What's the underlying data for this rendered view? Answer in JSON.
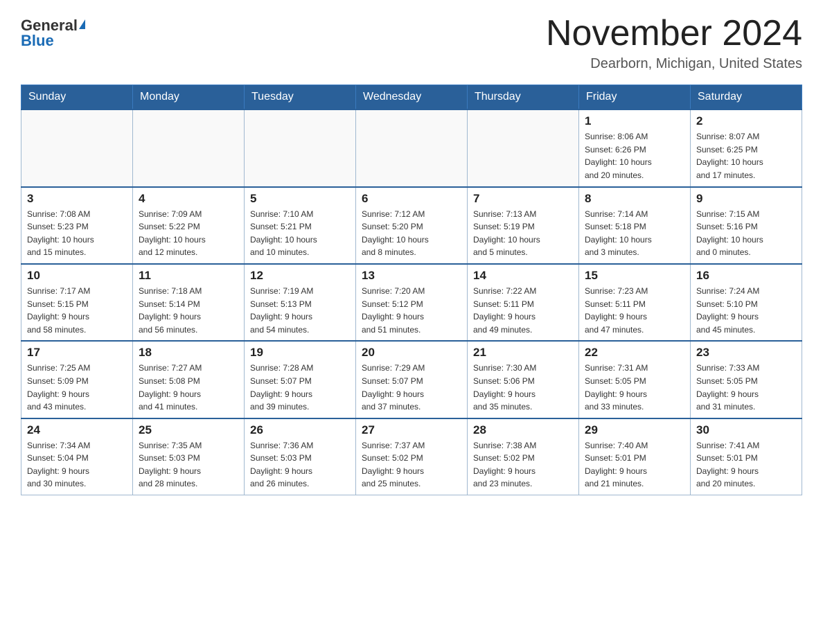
{
  "header": {
    "logo_general": "General",
    "logo_blue": "Blue",
    "month_title": "November 2024",
    "location": "Dearborn, Michigan, United States"
  },
  "weekdays": [
    "Sunday",
    "Monday",
    "Tuesday",
    "Wednesday",
    "Thursday",
    "Friday",
    "Saturday"
  ],
  "weeks": [
    [
      {
        "day": "",
        "info": ""
      },
      {
        "day": "",
        "info": ""
      },
      {
        "day": "",
        "info": ""
      },
      {
        "day": "",
        "info": ""
      },
      {
        "day": "",
        "info": ""
      },
      {
        "day": "1",
        "info": "Sunrise: 8:06 AM\nSunset: 6:26 PM\nDaylight: 10 hours\nand 20 minutes."
      },
      {
        "day": "2",
        "info": "Sunrise: 8:07 AM\nSunset: 6:25 PM\nDaylight: 10 hours\nand 17 minutes."
      }
    ],
    [
      {
        "day": "3",
        "info": "Sunrise: 7:08 AM\nSunset: 5:23 PM\nDaylight: 10 hours\nand 15 minutes."
      },
      {
        "day": "4",
        "info": "Sunrise: 7:09 AM\nSunset: 5:22 PM\nDaylight: 10 hours\nand 12 minutes."
      },
      {
        "day": "5",
        "info": "Sunrise: 7:10 AM\nSunset: 5:21 PM\nDaylight: 10 hours\nand 10 minutes."
      },
      {
        "day": "6",
        "info": "Sunrise: 7:12 AM\nSunset: 5:20 PM\nDaylight: 10 hours\nand 8 minutes."
      },
      {
        "day": "7",
        "info": "Sunrise: 7:13 AM\nSunset: 5:19 PM\nDaylight: 10 hours\nand 5 minutes."
      },
      {
        "day": "8",
        "info": "Sunrise: 7:14 AM\nSunset: 5:18 PM\nDaylight: 10 hours\nand 3 minutes."
      },
      {
        "day": "9",
        "info": "Sunrise: 7:15 AM\nSunset: 5:16 PM\nDaylight: 10 hours\nand 0 minutes."
      }
    ],
    [
      {
        "day": "10",
        "info": "Sunrise: 7:17 AM\nSunset: 5:15 PM\nDaylight: 9 hours\nand 58 minutes."
      },
      {
        "day": "11",
        "info": "Sunrise: 7:18 AM\nSunset: 5:14 PM\nDaylight: 9 hours\nand 56 minutes."
      },
      {
        "day": "12",
        "info": "Sunrise: 7:19 AM\nSunset: 5:13 PM\nDaylight: 9 hours\nand 54 minutes."
      },
      {
        "day": "13",
        "info": "Sunrise: 7:20 AM\nSunset: 5:12 PM\nDaylight: 9 hours\nand 51 minutes."
      },
      {
        "day": "14",
        "info": "Sunrise: 7:22 AM\nSunset: 5:11 PM\nDaylight: 9 hours\nand 49 minutes."
      },
      {
        "day": "15",
        "info": "Sunrise: 7:23 AM\nSunset: 5:11 PM\nDaylight: 9 hours\nand 47 minutes."
      },
      {
        "day": "16",
        "info": "Sunrise: 7:24 AM\nSunset: 5:10 PM\nDaylight: 9 hours\nand 45 minutes."
      }
    ],
    [
      {
        "day": "17",
        "info": "Sunrise: 7:25 AM\nSunset: 5:09 PM\nDaylight: 9 hours\nand 43 minutes."
      },
      {
        "day": "18",
        "info": "Sunrise: 7:27 AM\nSunset: 5:08 PM\nDaylight: 9 hours\nand 41 minutes."
      },
      {
        "day": "19",
        "info": "Sunrise: 7:28 AM\nSunset: 5:07 PM\nDaylight: 9 hours\nand 39 minutes."
      },
      {
        "day": "20",
        "info": "Sunrise: 7:29 AM\nSunset: 5:07 PM\nDaylight: 9 hours\nand 37 minutes."
      },
      {
        "day": "21",
        "info": "Sunrise: 7:30 AM\nSunset: 5:06 PM\nDaylight: 9 hours\nand 35 minutes."
      },
      {
        "day": "22",
        "info": "Sunrise: 7:31 AM\nSunset: 5:05 PM\nDaylight: 9 hours\nand 33 minutes."
      },
      {
        "day": "23",
        "info": "Sunrise: 7:33 AM\nSunset: 5:05 PM\nDaylight: 9 hours\nand 31 minutes."
      }
    ],
    [
      {
        "day": "24",
        "info": "Sunrise: 7:34 AM\nSunset: 5:04 PM\nDaylight: 9 hours\nand 30 minutes."
      },
      {
        "day": "25",
        "info": "Sunrise: 7:35 AM\nSunset: 5:03 PM\nDaylight: 9 hours\nand 28 minutes."
      },
      {
        "day": "26",
        "info": "Sunrise: 7:36 AM\nSunset: 5:03 PM\nDaylight: 9 hours\nand 26 minutes."
      },
      {
        "day": "27",
        "info": "Sunrise: 7:37 AM\nSunset: 5:02 PM\nDaylight: 9 hours\nand 25 minutes."
      },
      {
        "day": "28",
        "info": "Sunrise: 7:38 AM\nSunset: 5:02 PM\nDaylight: 9 hours\nand 23 minutes."
      },
      {
        "day": "29",
        "info": "Sunrise: 7:40 AM\nSunset: 5:01 PM\nDaylight: 9 hours\nand 21 minutes."
      },
      {
        "day": "30",
        "info": "Sunrise: 7:41 AM\nSunset: 5:01 PM\nDaylight: 9 hours\nand 20 minutes."
      }
    ]
  ]
}
